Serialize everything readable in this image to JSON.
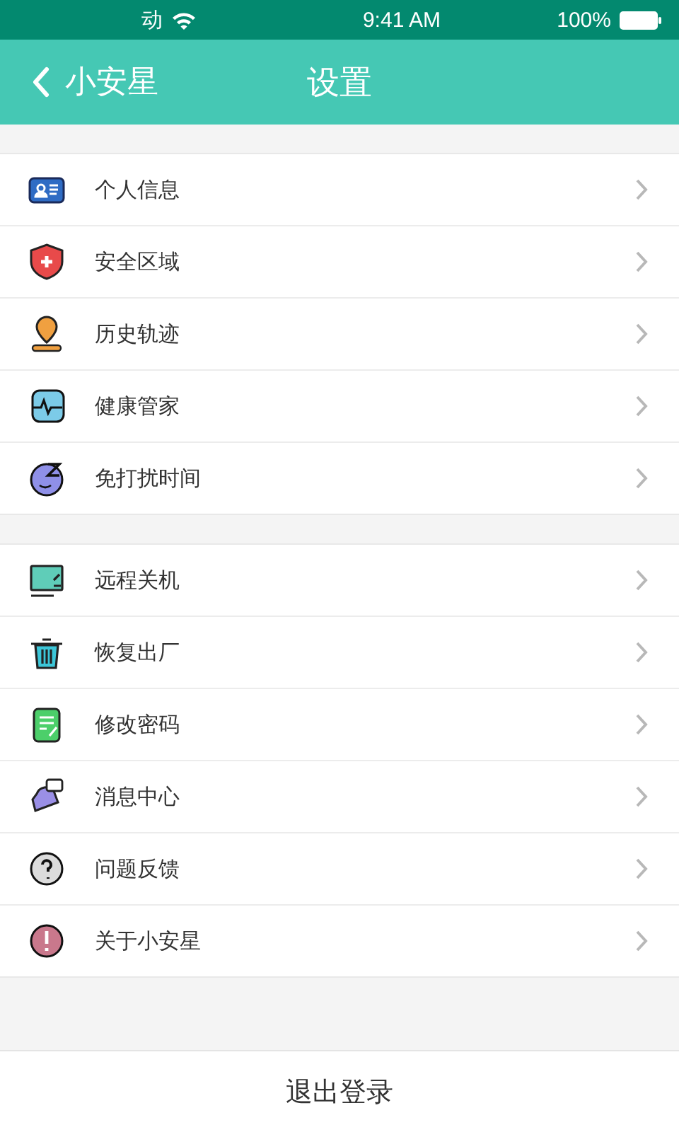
{
  "status_bar": {
    "carrier": "动",
    "time": "9:41 AM",
    "battery": "100%"
  },
  "nav_bar": {
    "back_label": "小安星",
    "title": "设置"
  },
  "groups": [
    {
      "items": [
        {
          "label": "个人信息"
        },
        {
          "label": "安全区域"
        },
        {
          "label": "历史轨迹"
        },
        {
          "label": "健康管家"
        },
        {
          "label": "免打扰时间"
        }
      ]
    },
    {
      "items": [
        {
          "label": "远程关机"
        },
        {
          "label": "恢复出厂"
        },
        {
          "label": "修改密码"
        },
        {
          "label": "消息中心"
        },
        {
          "label": "问题反馈"
        },
        {
          "label": "关于小安星"
        }
      ]
    }
  ],
  "logout_button": "退出登录"
}
